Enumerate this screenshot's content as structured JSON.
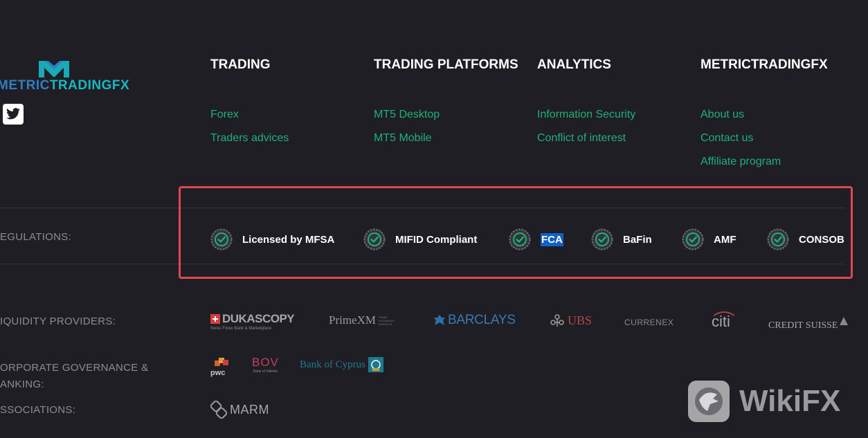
{
  "brand": {
    "name_part1": "METRIC",
    "name_part2": "TRADINGFX"
  },
  "social": {
    "twitter_icon": "twitter-icon"
  },
  "nav": {
    "columns": [
      {
        "title": "TRADING",
        "links": [
          "Forex",
          "Traders advices"
        ]
      },
      {
        "title": "TRADING PLATFORMS",
        "links": [
          "MT5 Desktop",
          "MT5 Mobile"
        ]
      },
      {
        "title": "ANALYTICS",
        "links": [
          "Information Security",
          "Conflict of interest"
        ]
      },
      {
        "title": "METRICTRADINGFX",
        "links": [
          "About us",
          "Contact us",
          "Affiliate program"
        ]
      }
    ]
  },
  "regulations": {
    "label": "EGULATIONS:",
    "items": [
      "Licensed by MFSA",
      "MIFID Compliant",
      "FCA",
      "BaFin",
      "AMF",
      "CONSOB"
    ]
  },
  "liquidity": {
    "label": "IQUIDITY PROVIDERS:",
    "logos": {
      "dukascopy": "DUKASCOPY",
      "dukascopy_sub": "Swiss Forex Bank & Marketplace",
      "primexm": "PrimeXM",
      "primexm_sub": "PRIME EXCHANGE MARKETS",
      "barclays": "BARCLAYS",
      "ubs": "UBS",
      "currenex": "CURRENEX",
      "citi": "citi",
      "credit_suisse": "CREDIT SUISSE"
    }
  },
  "governance": {
    "label_line1": "ORPORATE GOVERNANCE &",
    "label_line2": "ANKING:",
    "logos": {
      "pwc": "pwc",
      "bov": "BOV",
      "bov_sub": "Bank of Valletta",
      "bank_of_cyprus": "Bank of Cyprus"
    }
  },
  "associations": {
    "label": "SSOCIATIONS:",
    "logos": {
      "marm": "MARM"
    }
  },
  "watermark": {
    "text": "WikiFX"
  },
  "colors": {
    "background": "#1f1e24",
    "link": "#1fb07a",
    "highlight_border": "#e0484d",
    "brand_blue": "#2f7fc2",
    "brand_teal": "#16b9c4"
  }
}
